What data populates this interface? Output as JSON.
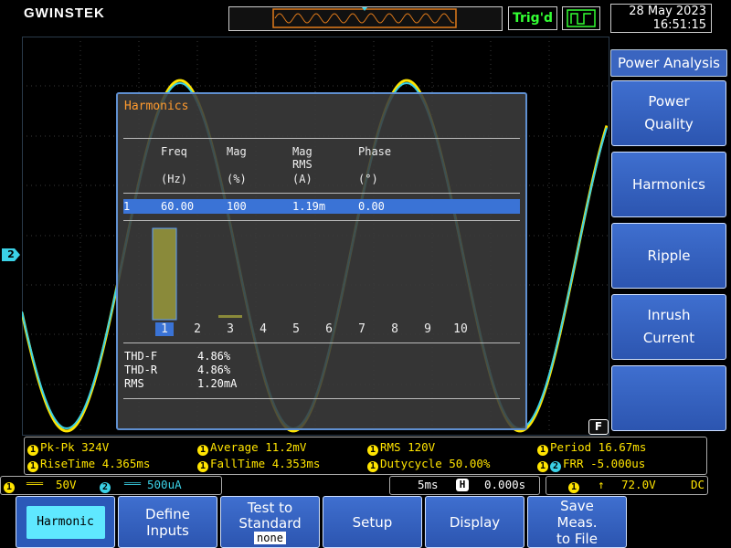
{
  "brand": "GWINSTEK",
  "header": {
    "trigger_status": "Trig'd",
    "date": "28 May 2023",
    "time": "16:51:15"
  },
  "ch2_marker": "2",
  "harmonics": {
    "title": "Harmonics",
    "columns": [
      {
        "name": "Freq",
        "unit": "(Hz)"
      },
      {
        "name": "Mag",
        "unit": "(%)"
      },
      {
        "name": "Mag\nRMS",
        "unit": "(A)"
      },
      {
        "name": "Phase",
        "unit": "(°)"
      }
    ],
    "selected_row": {
      "index": "1",
      "freq": "60.00",
      "mag": "100",
      "mag_rms": "1.19m",
      "phase": "0.00"
    },
    "orders": [
      "1",
      "2",
      "3",
      "4",
      "5",
      "6",
      "7",
      "8",
      "9",
      "10"
    ],
    "selected_order": "1",
    "bar_magnitudes_pct": [
      100,
      0,
      4,
      0,
      0,
      0,
      0,
      0,
      0,
      0
    ],
    "thd_f_label": "THD-F",
    "thd_f": "4.86%",
    "thd_r_label": "THD-R",
    "thd_r": "4.86%",
    "rms_label": "RMS",
    "rms": "1.20mA",
    "f_badge": "F"
  },
  "side_menu": {
    "title": "Power Analysis",
    "items": [
      "Power\nQuality",
      "Harmonics",
      "Ripple",
      "Inrush\nCurrent",
      ""
    ]
  },
  "measurements": [
    {
      "label": "Pk-Pk 324V",
      "ch": "1"
    },
    {
      "label": "Average 11.2mV",
      "ch": "1"
    },
    {
      "label": "RMS 120V",
      "ch": "1"
    },
    {
      "label": "Period 16.67ms",
      "ch": "1"
    },
    {
      "label": "RiseTime 4.365ms",
      "ch": "1"
    },
    {
      "label": "FallTime 4.353ms",
      "ch": "1"
    },
    {
      "label": "Dutycycle 50.00%",
      "ch": "1"
    },
    {
      "label": "FRR -5.000us",
      "ch": "1",
      "ch_b": "2"
    }
  ],
  "status": {
    "ch1_num": "1",
    "ch1_coupling": "═══",
    "ch1_scale": "50V",
    "ch2_num": "2",
    "ch2_coupling": "═══",
    "ch2_scale": "500uA",
    "timebase": "5ms",
    "horiz_icon": "H",
    "position": "0.000s",
    "trig_ch": "1",
    "trig_slope": "↑",
    "trig_level": "72.0V",
    "trig_coupling": "DC"
  },
  "bottom_menu": {
    "harmonic": "Harmonic",
    "define_inputs": "Define\nInputs",
    "test_to_standard": "Test to\nStandard",
    "test_value": "none",
    "setup": "Setup",
    "display": "Display",
    "save": "Save\nMeas.\nto File"
  },
  "colors": {
    "ch1": "#ffe400",
    "ch2": "#3bd1e6",
    "menu": "#2c55b0",
    "title": "#ff9a2e"
  }
}
